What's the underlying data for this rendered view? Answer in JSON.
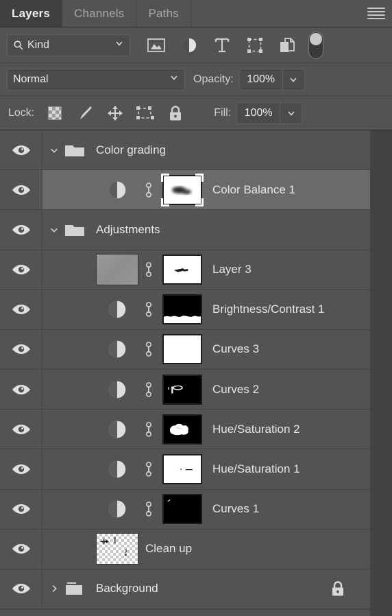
{
  "panel": {
    "tabs": [
      {
        "label": "Layers",
        "active": true
      },
      {
        "label": "Channels",
        "active": false
      },
      {
        "label": "Paths",
        "active": false
      }
    ],
    "menu_icon": "hamburger-menu-icon"
  },
  "filter": {
    "kind_label": "Kind",
    "search_icon": "search-icon",
    "caret_icon": "chevron-down-icon",
    "type_icons": [
      "pixel-layer-filter-icon",
      "adjustment-layer-filter-icon",
      "type-layer-filter-icon",
      "shape-layer-filter-icon",
      "smart-object-filter-icon"
    ],
    "toggle_state": "off"
  },
  "blend": {
    "mode": "Normal",
    "opacity_label": "Opacity:",
    "opacity_value": "100%"
  },
  "lock": {
    "label": "Lock:",
    "icons": [
      "lock-transparent-pixels-icon",
      "lock-image-pixels-icon",
      "lock-position-icon",
      "lock-artboard-nesting-icon",
      "lock-all-icon"
    ],
    "fill_label": "Fill:",
    "fill_value": "100%"
  },
  "colors": {
    "panel_bg": "#535353",
    "selected_row": "#6a6a6a",
    "tab_active_bg": "#3f3f3f",
    "text": "#e6e6e6",
    "divider": "#464646",
    "scrollbar_track": "#434343"
  },
  "layers": [
    {
      "name": "Color grading",
      "type": "group",
      "visible": true,
      "expanded": true,
      "indent": 0,
      "selected": false,
      "locked": false
    },
    {
      "name": "Color Balance 1",
      "type": "adjustment",
      "visible": true,
      "indent": 1,
      "selected": true,
      "linked": true,
      "mask": "blurred-dark-blob-on-white",
      "mask_active": true,
      "locked": false
    },
    {
      "name": "Adjustments",
      "type": "group",
      "visible": true,
      "expanded": true,
      "indent": 0,
      "selected": false,
      "locked": false
    },
    {
      "name": "Layer 3",
      "type": "pixel",
      "visible": true,
      "indent": 1,
      "selected": false,
      "linked": true,
      "mask": "small-dark-stroke-on-white",
      "mask_active": false,
      "locked": false
    },
    {
      "name": "Brightness/Contrast 1",
      "type": "adjustment",
      "visible": true,
      "indent": 1,
      "selected": false,
      "linked": true,
      "mask": "black-top-white-bottom",
      "mask_active": false,
      "locked": false
    },
    {
      "name": "Curves 3",
      "type": "adjustment",
      "visible": true,
      "indent": 1,
      "selected": false,
      "linked": true,
      "mask": "all-white",
      "mask_active": false,
      "locked": false
    },
    {
      "name": "Curves 2",
      "type": "adjustment",
      "visible": true,
      "indent": 1,
      "selected": false,
      "linked": true,
      "mask": "black-with-small-white-marks",
      "mask_active": false,
      "locked": false
    },
    {
      "name": "Hue/Saturation 2",
      "type": "adjustment",
      "visible": true,
      "indent": 1,
      "selected": false,
      "linked": true,
      "mask": "white-cloud-blob-on-black",
      "mask_active": false,
      "locked": false
    },
    {
      "name": "Hue/Saturation 1",
      "type": "adjustment",
      "visible": true,
      "indent": 1,
      "selected": false,
      "linked": true,
      "mask": "white-with-small-dark-marks",
      "mask_active": false,
      "locked": false
    },
    {
      "name": "Curves 1",
      "type": "adjustment",
      "visible": true,
      "indent": 1,
      "selected": false,
      "linked": true,
      "mask": "black-with-tiny-white-tick",
      "mask_active": false,
      "locked": false
    },
    {
      "name": "Clean up",
      "type": "pixel-transparent",
      "visible": true,
      "indent": 1,
      "selected": false,
      "linked": false,
      "mask": null,
      "locked": false
    },
    {
      "name": "Background",
      "type": "group",
      "visible": true,
      "expanded": false,
      "indent": 0,
      "selected": false,
      "locked": true
    }
  ]
}
